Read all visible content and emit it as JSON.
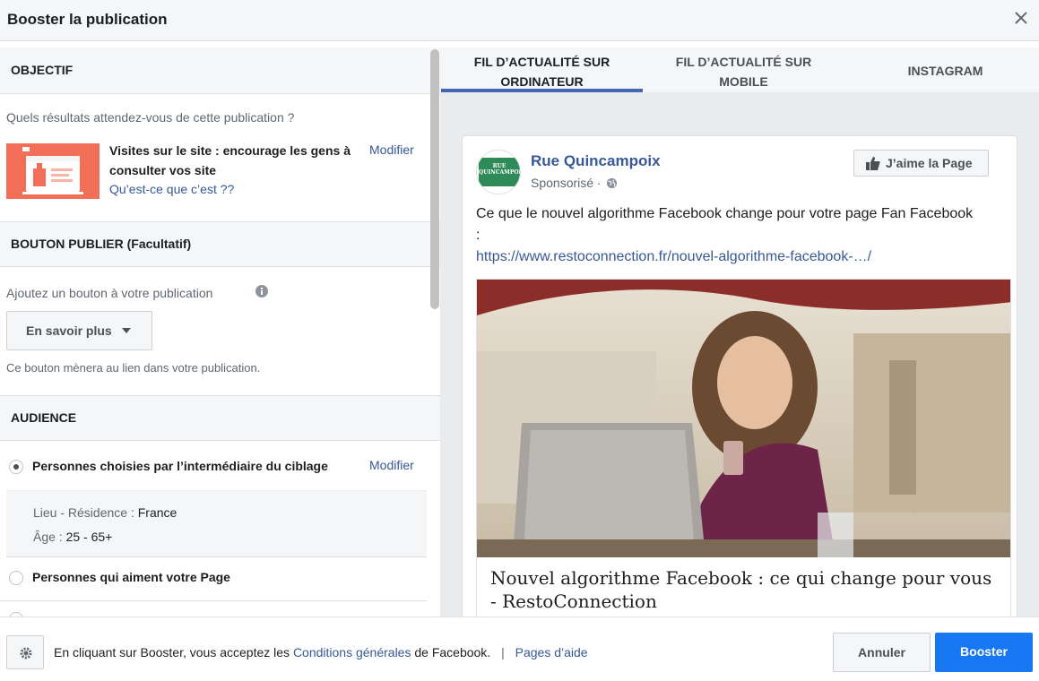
{
  "dialog": {
    "title": "Booster la publication"
  },
  "objective": {
    "header": "OBJECTIF",
    "question": "Quels résultats attendez-vous de cette publication ?",
    "title": "Visites sur le site : encourage les gens à consulter vos site",
    "help_link": "Qu’est-ce que c’est ??",
    "modify": "Modifier"
  },
  "publish_button": {
    "header": "BOUTON PUBLIER (Facultatif)",
    "label": "Ajoutez un bouton à votre publication",
    "select_value": "En savoir plus",
    "hint": "Ce bouton mènera au lien dans votre publication."
  },
  "audience": {
    "header": "AUDIENCE",
    "option1": "Personnes choisies par l’intermédiaire du ciblage",
    "modify": "Modifier",
    "location_label": "Lieu - Résidence :",
    "location_value": "France",
    "age_label": "Âge :",
    "age_value": "25 - 65+",
    "option2": "Personnes qui aiment votre Page"
  },
  "tabs": [
    {
      "line1": "FIL D’ACTUALITÉ SUR",
      "line2": "ORDINATEUR"
    },
    {
      "line1": "FIL D’ACTUALITÉ SUR",
      "line2": "MOBILE"
    },
    {
      "line1": "INSTAGRAM",
      "line2": ""
    }
  ],
  "post": {
    "page_name": "Rue Quincampoix",
    "sponsored": "Sponsorisé ·",
    "like_button": "J’aime la Page",
    "text": "Ce que le nouvel algorithme Facebook change pour votre page Fan Facebook :",
    "url": "https://www.restoconnection.fr/nouvel-algorithme-facebook-…/",
    "link_title": "Nouvel algorithme Facebook : ce qui change pour vous - RestoConnection",
    "avatar_text": "RUE QUINCAMPOIX"
  },
  "footer": {
    "text_before": "En cliquant sur Booster, vous acceptez les",
    "terms_link": "Conditions générales",
    "text_after": "de Facebook.",
    "separator": "|",
    "help_link": "Pages d’aide",
    "cancel": "Annuler",
    "boost": "Booster"
  },
  "colors": {
    "accent": "#4267b2",
    "boost_button": "#1877f2",
    "link": "#365899"
  }
}
